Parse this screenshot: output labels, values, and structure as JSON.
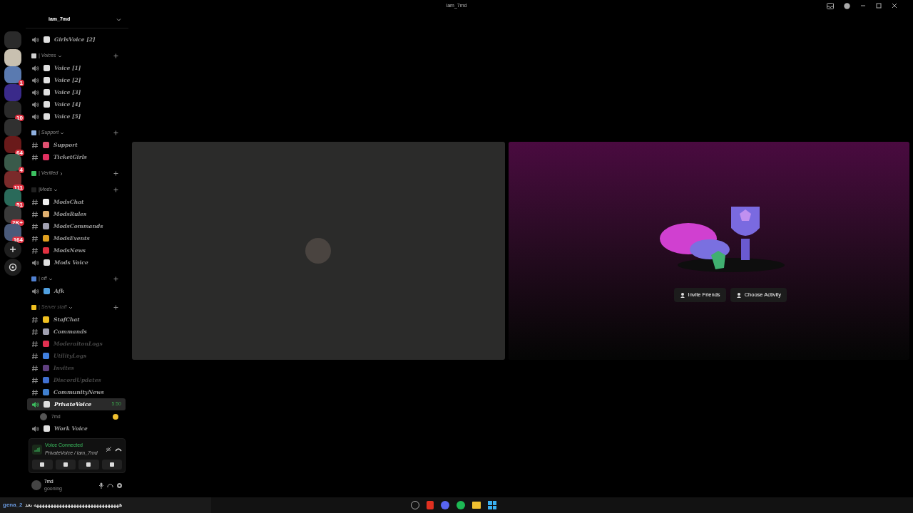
{
  "window": {
    "title": "iam_7md"
  },
  "servers": [
    {
      "kind": "home"
    },
    {
      "kind": "server",
      "color": "#c8c0b0"
    },
    {
      "kind": "server",
      "color": "#5a7ab0",
      "badge": "1"
    },
    {
      "kind": "server",
      "color": "#3a2a8a"
    },
    {
      "kind": "server",
      "color": "#2a2a2a",
      "badge": "10"
    },
    {
      "kind": "server",
      "color": "#303030"
    },
    {
      "kind": "server",
      "color": "#6a1a1a",
      "badge": "64"
    },
    {
      "kind": "server",
      "color": "#3a5a4a",
      "badge": "4"
    },
    {
      "kind": "server",
      "color": "#7a2a2a",
      "badge": "111"
    },
    {
      "kind": "server",
      "color": "#2a6a5a",
      "badge": "51"
    },
    {
      "kind": "server",
      "color": "#3a3a3a",
      "badge": "2K+"
    },
    {
      "kind": "server",
      "color": "#4a5a7a",
      "badge": "164"
    },
    {
      "kind": "add"
    },
    {
      "kind": "discover"
    }
  ],
  "server_name": "iam_7md",
  "channels": [
    {
      "kind": "voice",
      "name": "GirlsVoice [2]",
      "color": "#e0e0e0",
      "muted": false,
      "selected": false
    },
    {
      "kind": "category",
      "name": "| Voices",
      "color": "#d0d0d0",
      "expanded": true,
      "muted": false
    },
    {
      "kind": "voice",
      "name": "Voice [1]",
      "color": "#e0e0e0",
      "muted": false,
      "selected": false
    },
    {
      "kind": "voice",
      "name": "Voice [2]",
      "color": "#e0e0e0",
      "muted": false,
      "selected": false
    },
    {
      "kind": "voice",
      "name": "Voice [3]",
      "color": "#e0e0e0",
      "muted": false,
      "selected": false
    },
    {
      "kind": "voice",
      "name": "Voice [4]",
      "color": "#e0e0e0",
      "muted": false,
      "selected": false
    },
    {
      "kind": "voice",
      "name": "Voice [5]",
      "color": "#e0e0e0",
      "muted": false,
      "selected": false
    },
    {
      "kind": "category",
      "name": "| Support",
      "color": "#8fb0e0",
      "expanded": true,
      "muted": false
    },
    {
      "kind": "text",
      "name": "Support",
      "color": "#e05070",
      "muted": false,
      "selected": false
    },
    {
      "kind": "text",
      "name": "TicketGirls",
      "color": "#e03060",
      "muted": false,
      "selected": false
    },
    {
      "kind": "category",
      "name": "| Verified",
      "color": "#3cc060",
      "expanded": false,
      "muted": false
    },
    {
      "kind": "category",
      "name": "|Mods",
      "color": "#202020",
      "expanded": true,
      "muted": false
    },
    {
      "kind": "text",
      "name": "ModsChat",
      "color": "#f0f0f0",
      "muted": false,
      "selected": false
    },
    {
      "kind": "text",
      "name": "ModsRules",
      "color": "#e0b070",
      "muted": false,
      "selected": false
    },
    {
      "kind": "text",
      "name": "ModsCommands",
      "color": "#a0a0b0",
      "muted": false,
      "selected": false
    },
    {
      "kind": "text",
      "name": "ModsEvents",
      "color": "#e0a020",
      "muted": false,
      "selected": false
    },
    {
      "kind": "text",
      "name": "ModsNews",
      "color": "#e03040",
      "muted": false,
      "selected": false
    },
    {
      "kind": "voice",
      "name": "Mods Voice",
      "color": "#e0e0e0",
      "muted": false,
      "selected": false
    },
    {
      "kind": "category",
      "name": "| off",
      "color": "#5080d0",
      "expanded": true,
      "muted": false
    },
    {
      "kind": "voice",
      "name": "Afk",
      "color": "#50a0e0",
      "muted": false,
      "selected": false
    },
    {
      "kind": "category",
      "name": "| Server staff",
      "color": "#f0c020",
      "expanded": true,
      "muted": true
    },
    {
      "kind": "text",
      "name": "StafChat",
      "color": "#f0c020",
      "muted": false,
      "selected": false
    },
    {
      "kind": "text",
      "name": "Commands",
      "color": "#a0a0b0",
      "muted": false,
      "selected": false
    },
    {
      "kind": "text",
      "name": "ModeraitonLogs",
      "color": "#e03050",
      "muted": true,
      "selected": false
    },
    {
      "kind": "text",
      "name": "UtilityLogs",
      "color": "#4080e0",
      "muted": true,
      "selected": false
    },
    {
      "kind": "text",
      "name": "Invites",
      "color": "#604080",
      "muted": true,
      "selected": false
    },
    {
      "kind": "text",
      "name": "DiscordUpdates",
      "color": "#4070d0",
      "muted": true,
      "selected": false
    },
    {
      "kind": "text",
      "name": "CommunityNews",
      "color": "#4080d0",
      "muted": false,
      "selected": false
    },
    {
      "kind": "voice",
      "name": "PrivateVoice",
      "color": "#e0e0e0",
      "muted": false,
      "selected": true,
      "time": "5:50"
    },
    {
      "kind": "member",
      "name": "7md"
    },
    {
      "kind": "voice",
      "name": "Work Voice",
      "color": "#e0e0e0",
      "muted": false,
      "selected": false
    }
  ],
  "voice_panel": {
    "status": "Voice Connected",
    "channel": "PrivateVoice / iam_7md"
  },
  "user": {
    "name": "7md",
    "status": "gooning"
  },
  "activity": {
    "buttons": [
      "Invite Friends",
      "Choose Activity"
    ]
  },
  "taskbar": {
    "ticker_user": "gena_2",
    "ticker_text": "ههههههههههههههههههههههههههههههه بعد"
  }
}
